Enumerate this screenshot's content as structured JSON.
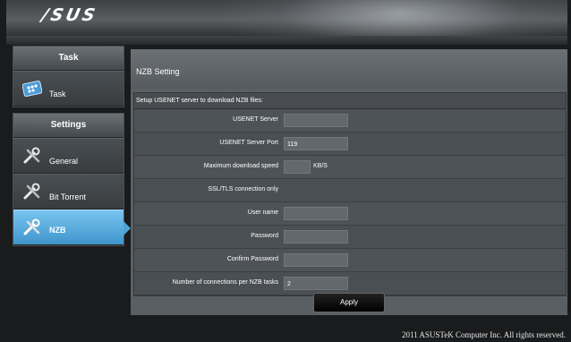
{
  "brand": {
    "logo": "/SUS"
  },
  "sidebar": {
    "task_section": {
      "header": "Task",
      "items": [
        {
          "label": "Task",
          "icon": "task-grid-icon"
        }
      ]
    },
    "settings_section": {
      "header": "Settings",
      "items": [
        {
          "label": "General",
          "icon": "tools-icon",
          "active": false
        },
        {
          "label": "Bit Torrent",
          "icon": "tools-icon",
          "active": false
        },
        {
          "label": "NZB",
          "icon": "tools-icon",
          "active": true
        }
      ]
    }
  },
  "main": {
    "title": "NZB Setting",
    "section_header": "Setup USENET server to download NZB files:",
    "fields": [
      {
        "label": "USENET Server",
        "value": ""
      },
      {
        "label": "USENET Server Port",
        "value": "119"
      },
      {
        "label": "Maximum download speed",
        "value": "",
        "unit": "KB/S"
      },
      {
        "label": "SSL/TLS connection only",
        "value": ""
      },
      {
        "label": "User name",
        "value": ""
      },
      {
        "label": "Password",
        "value": ""
      },
      {
        "label": "Confirm Password",
        "value": ""
      },
      {
        "label": "Number of connections per NZB tasks",
        "value": "2"
      }
    ],
    "apply_label": "Apply"
  },
  "footer": {
    "copyright": "2011 ASUSTeK Computer Inc. All rights reserved."
  },
  "colors": {
    "active_tab": "#4da3d6",
    "panel": "#5a5f63",
    "background": "#1a1b1c"
  }
}
